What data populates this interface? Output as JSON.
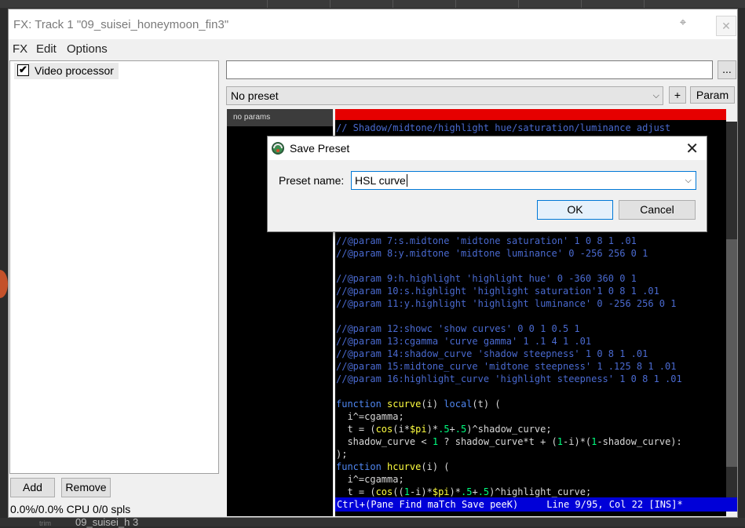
{
  "window": {
    "title": "FX: Track 1 \"09_suisei_honeymoon_fin3\""
  },
  "menu": [
    "FX",
    "Edit",
    "Options"
  ],
  "fx_list": [
    {
      "name": "Video processor",
      "enabled": true
    }
  ],
  "buttons": {
    "add": "Add",
    "remove": "Remove",
    "browse": "...",
    "plus": "+",
    "param": "Param"
  },
  "status": "0.0%/0.0% CPU 0/0 spls",
  "preset": {
    "input_value": "",
    "selected": "No preset"
  },
  "params_header": "no params",
  "code_lines": [
    [
      [
        "c",
        "// Shadow/midtone/highlight hue/saturation/luminance adjust"
      ]
    ],
    [],
    [],
    [],
    [],
    [],
    [],
    [],
    [],
    [
      [
        "c",
        "//@param 7:s.midtone 'midtone saturation' 1 0 8 1 .01"
      ]
    ],
    [
      [
        "c",
        "//@param 8:y.midtone 'midtone luminance' 0 -256 256 0 1"
      ]
    ],
    [],
    [
      [
        "c",
        "//@param 9:h.highlight 'highlight hue' 0 -360 360 0 1"
      ]
    ],
    [
      [
        "c",
        "//@param 10:s.highlight 'highlight saturation'1 0 8 1 .01"
      ]
    ],
    [
      [
        "c",
        "//@param 11:y.highlight 'highlight luminance' 0 -256 256 0 1"
      ]
    ],
    [],
    [
      [
        "c",
        "//@param 12:showc 'show curves' 0 0 1 0.5 1"
      ]
    ],
    [
      [
        "c",
        "//@param 13:cgamma 'curve gamma' 1 .1 4 1 .01"
      ]
    ],
    [
      [
        "c",
        "//@param 14:shadow_curve 'shadow steepness' 1 0 8 1 .01"
      ]
    ],
    [
      [
        "c",
        "//@param 15:midtone_curve 'midtone steepness' 1 .125 8 1 .01"
      ]
    ],
    [
      [
        "c",
        "//@param 16:highlight_curve 'highlight steepness' 1 0 8 1 .01"
      ]
    ],
    [],
    [
      [
        "k",
        "function "
      ],
      [
        "y",
        "scurve"
      ],
      [
        "w",
        "(i) "
      ],
      [
        "k",
        "local"
      ],
      [
        "w",
        "(t) ("
      ]
    ],
    [
      [
        "w",
        "  i^=cgamma;"
      ]
    ],
    [
      [
        "w",
        "  t = ("
      ],
      [
        "y",
        "cos"
      ],
      [
        "w",
        "(i*"
      ],
      [
        "y",
        "$pi"
      ],
      [
        "w",
        ")*"
      ],
      [
        "n",
        ".5"
      ],
      [
        "w",
        "+"
      ],
      [
        "n",
        ".5"
      ],
      [
        "w",
        ")^shadow_curve;"
      ]
    ],
    [
      [
        "w",
        "  shadow_curve < "
      ],
      [
        "n",
        "1"
      ],
      [
        "w",
        " ? shadow_curve*t + ("
      ],
      [
        "n",
        "1"
      ],
      [
        "w",
        "-i)*("
      ],
      [
        "n",
        "1"
      ],
      [
        "w",
        "-shadow_curve):"
      ]
    ],
    [
      [
        "w",
        ");"
      ]
    ],
    [
      [
        "k",
        "function "
      ],
      [
        "y",
        "hcurve"
      ],
      [
        "w",
        "(i) ("
      ]
    ],
    [
      [
        "w",
        "  i^=cgamma;"
      ]
    ],
    [
      [
        "w",
        "  t = ("
      ],
      [
        "y",
        "cos"
      ],
      [
        "w",
        "(("
      ],
      [
        "n",
        "1"
      ],
      [
        "w",
        "-i)*"
      ],
      [
        "y",
        "$pi"
      ],
      [
        "w",
        ")*"
      ],
      [
        "n",
        ".5"
      ],
      [
        "w",
        "+"
      ],
      [
        "n",
        ".5"
      ],
      [
        "w",
        ")^highlight_curve;"
      ]
    ]
  ],
  "editor_status": "Ctrl+(Pane Find maTch Save peeK)     Line 9/95, Col 22 [INS]*",
  "dialog": {
    "title": "Save Preset",
    "label": "Preset name:",
    "value": "HSL curve",
    "ok": "OK",
    "cancel": "Cancel"
  },
  "background": {
    "track_text": "09_suisei_h 3",
    "trim_label": "trim"
  },
  "colors": {
    "editor_bg": "#000000",
    "comment": "#4a6ad0",
    "keyword": "#4f86f0",
    "number": "#00ff80",
    "builtin": "#ffff40",
    "status_bg": "#0000d8",
    "error_bar": "#e60000",
    "accent": "#0078d7"
  }
}
